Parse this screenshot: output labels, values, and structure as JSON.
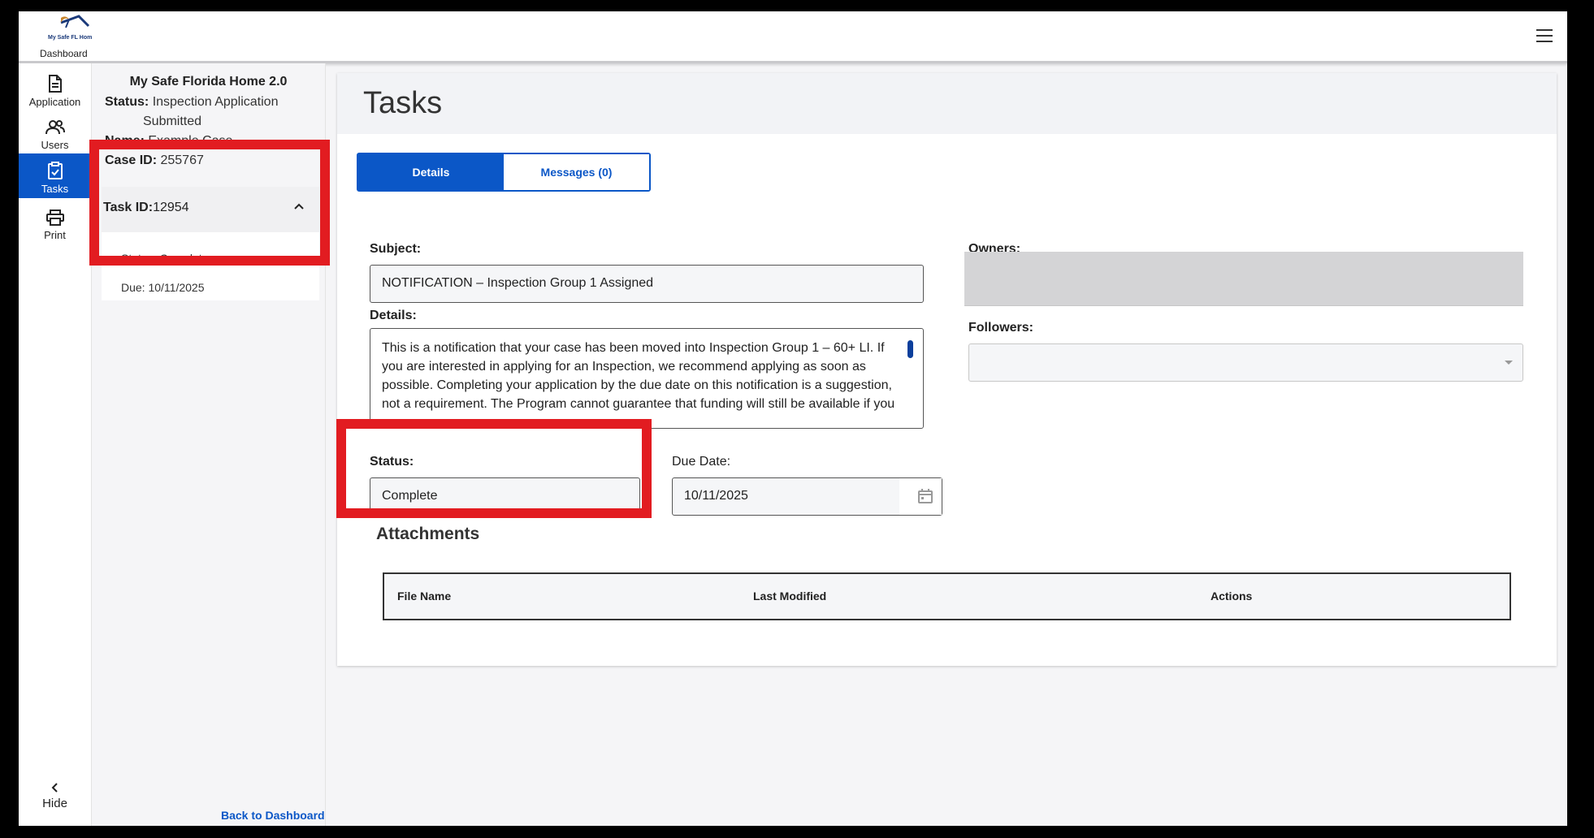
{
  "topbar": {
    "logo_label": "Dashboard",
    "logo_alt": "My Safe FL Home"
  },
  "nav": [
    {
      "label": "Application",
      "icon": "document-icon"
    },
    {
      "label": "Users",
      "icon": "users-icon"
    },
    {
      "label": "Tasks",
      "icon": "clipboard-check-icon"
    },
    {
      "label": "Print",
      "icon": "printer-icon"
    }
  ],
  "nav_hide": "Hide",
  "case": {
    "program": "My Safe Florida Home 2.0",
    "status_label": "Status:",
    "status_value": "Inspection Application",
    "status_value2": "Submitted",
    "name_label": "Name:",
    "name_value": "Example Case",
    "caseid_label": "Case ID:",
    "caseid_value": "255767"
  },
  "task_card": {
    "id_label": "Task ID:",
    "id_value": "12954",
    "status": "Status: Complete",
    "due": "Due: 10/11/2025"
  },
  "back_link": "Back to Dashboard",
  "main": {
    "title": "Tasks",
    "tabs": [
      {
        "label": "Details"
      },
      {
        "label": "Messages (0)"
      }
    ],
    "subject_label": "Subject:",
    "subject_value": "NOTIFICATION – Inspection Group 1 Assigned",
    "details_label": "Details:",
    "details_value": "This is a notification that your case has been moved into Inspection Group 1 – 60+ LI. If you are interested in applying for an Inspection, we recommend applying as soon as possible. Completing your application by the due date on this notification is a suggestion, not a requirement. The Program cannot guarantee that funding will still be available if you",
    "status_label": "Status:",
    "status_value": "Complete",
    "due_label": "Due Date:",
    "due_value": "10/11/2025",
    "owners_label": "Owners:",
    "followers_label": "Followers:",
    "attachments_title": "Attachments",
    "attachments_columns": [
      "File Name",
      "Last Modified",
      "Actions"
    ]
  },
  "colors": {
    "accent": "#0b57c7",
    "highlight": "#e21c21"
  }
}
